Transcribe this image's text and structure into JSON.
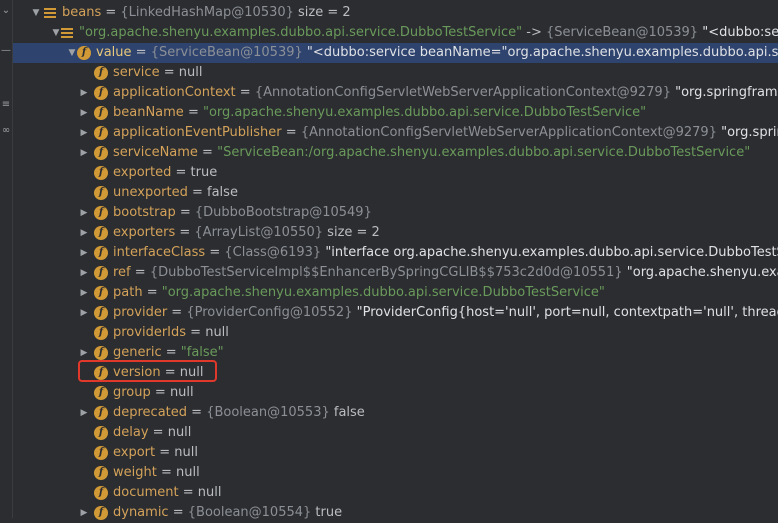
{
  "gutter_icons": [
    "chevron-down-icon",
    "dash-icon",
    "list-icon",
    "link-icon"
  ],
  "rows": [
    {
      "level": 0,
      "arrow": "down",
      "icon": "list",
      "name": "beans",
      "op": " = ",
      "ref": "{LinkedHashMap@10530}",
      "tail": "  size = 2",
      "tail_class": "plain"
    },
    {
      "level": 1,
      "arrow": "down",
      "icon": "list",
      "name": "\"org.apache.shenyu.examples.dubbo.api.service.DubboTestService\"",
      "name_class": "str",
      "op": " -> ",
      "ref": "{ServiceBean@10539}",
      "tail": " \"<dubbo:service bea",
      "tail_class": "white"
    },
    {
      "level": 2,
      "arrow": "down",
      "icon": "field",
      "name": "value",
      "op": " = ",
      "ref": "{ServiceBean@10539}",
      "tail": " \"<dubbo:service beanName=\"org.apache.shenyu.examples.dubbo.api.service.Dubb",
      "tail_class": "white",
      "selected": true
    },
    {
      "level": 3,
      "arrow": "none",
      "icon": "field",
      "name": "service",
      "op": " = ",
      "ref": "",
      "tail": "null",
      "tail_class": "plain"
    },
    {
      "level": 3,
      "arrow": "right",
      "icon": "field",
      "name": "applicationContext",
      "op": " = ",
      "ref": "{AnnotationConfigServletWebServerApplicationContext@9279}",
      "tail": " \"org.springframework.b",
      "tail_class": "white"
    },
    {
      "level": 3,
      "arrow": "right",
      "icon": "field",
      "name": "beanName",
      "op": " = ",
      "ref": "",
      "tail": "\"org.apache.shenyu.examples.dubbo.api.service.DubboTestService\"",
      "tail_class": "str"
    },
    {
      "level": 3,
      "arrow": "right",
      "icon": "field",
      "name": "applicationEventPublisher",
      "op": " = ",
      "ref": "{AnnotationConfigServletWebServerApplicationContext@9279}",
      "tail": " \"org.springframe",
      "tail_class": "white"
    },
    {
      "level": 3,
      "arrow": "right",
      "icon": "field",
      "name": "serviceName",
      "op": " = ",
      "ref": "",
      "tail": "\"ServiceBean:/org.apache.shenyu.examples.dubbo.api.service.DubboTestService\"",
      "tail_class": "str"
    },
    {
      "level": 3,
      "arrow": "none",
      "icon": "field",
      "name": "exported",
      "op": " = ",
      "ref": "",
      "tail": "true",
      "tail_class": "plain"
    },
    {
      "level": 3,
      "arrow": "none",
      "icon": "field",
      "name": "unexported",
      "op": " = ",
      "ref": "",
      "tail": "false",
      "tail_class": "plain"
    },
    {
      "level": 3,
      "arrow": "right",
      "icon": "field",
      "name": "bootstrap",
      "op": " = ",
      "ref": "{DubboBootstrap@10549}",
      "tail": "",
      "tail_class": "plain"
    },
    {
      "level": 3,
      "arrow": "right",
      "icon": "field-lock",
      "name": "exporters",
      "op": " = ",
      "ref": "{ArrayList@10550}",
      "tail": "  size = 2",
      "tail_class": "plain"
    },
    {
      "level": 3,
      "arrow": "right",
      "icon": "field",
      "name": "interfaceClass",
      "op": " = ",
      "ref": "{Class@6193}",
      "tail": " \"interface org.apache.shenyu.examples.dubbo.api.service.DubboTestService\"",
      "tail_class": "white"
    },
    {
      "level": 3,
      "arrow": "right",
      "icon": "field",
      "name": "ref",
      "op": " = ",
      "ref": "{DubboTestServiceImpl$$EnhancerBySpringCGLIB$$753c2d0d@10551}",
      "tail": " \"org.apache.shenyu.examples.a",
      "tail_class": "white"
    },
    {
      "level": 3,
      "arrow": "right",
      "icon": "field",
      "name": "path",
      "op": " = ",
      "ref": "",
      "tail": "\"org.apache.shenyu.examples.dubbo.api.service.DubboTestService\"",
      "tail_class": "str"
    },
    {
      "level": 3,
      "arrow": "right",
      "icon": "field",
      "name": "provider",
      "op": " = ",
      "ref": "{ProviderConfig@10552}",
      "tail": " \"ProviderConfig{host='null', port=null, contextpath='null', threadpool='nu",
      "tail_class": "white"
    },
    {
      "level": 3,
      "arrow": "none",
      "icon": "field",
      "name": "providerIds",
      "op": " = ",
      "ref": "",
      "tail": "null",
      "tail_class": "plain"
    },
    {
      "level": 3,
      "arrow": "right",
      "icon": "field",
      "name": "generic",
      "op": " = ",
      "ref": "",
      "tail": "\"false\"",
      "tail_class": "str"
    },
    {
      "level": 3,
      "arrow": "none",
      "icon": "field",
      "name": "version",
      "op": " = ",
      "ref": "",
      "tail": "null",
      "tail_class": "plain",
      "highlighted": true
    },
    {
      "level": 3,
      "arrow": "none",
      "icon": "field",
      "name": "group",
      "op": " = ",
      "ref": "",
      "tail": "null",
      "tail_class": "plain"
    },
    {
      "level": 3,
      "arrow": "right",
      "icon": "field",
      "name": "deprecated",
      "op": " = ",
      "ref": "{Boolean@10553}",
      "tail": " false",
      "tail_class": "plain"
    },
    {
      "level": 3,
      "arrow": "none",
      "icon": "field",
      "name": "delay",
      "op": " = ",
      "ref": "",
      "tail": "null",
      "tail_class": "plain"
    },
    {
      "level": 3,
      "arrow": "none",
      "icon": "field",
      "name": "export",
      "op": " = ",
      "ref": "",
      "tail": "null",
      "tail_class": "plain"
    },
    {
      "level": 3,
      "arrow": "none",
      "icon": "field",
      "name": "weight",
      "op": " = ",
      "ref": "",
      "tail": "null",
      "tail_class": "plain"
    },
    {
      "level": 3,
      "arrow": "none",
      "icon": "field",
      "name": "document",
      "op": " = ",
      "ref": "",
      "tail": "null",
      "tail_class": "plain"
    },
    {
      "level": 3,
      "arrow": "right",
      "icon": "field",
      "name": "dynamic",
      "op": " = ",
      "ref": "{Boolean@10554}",
      "tail": " true",
      "tail_class": "plain"
    }
  ],
  "icon_letter": "f",
  "colors": {
    "selection": "#2e436e",
    "highlight_box": "#e0382b",
    "field_icon": "#d19a36",
    "string": "#6a9a5b"
  }
}
